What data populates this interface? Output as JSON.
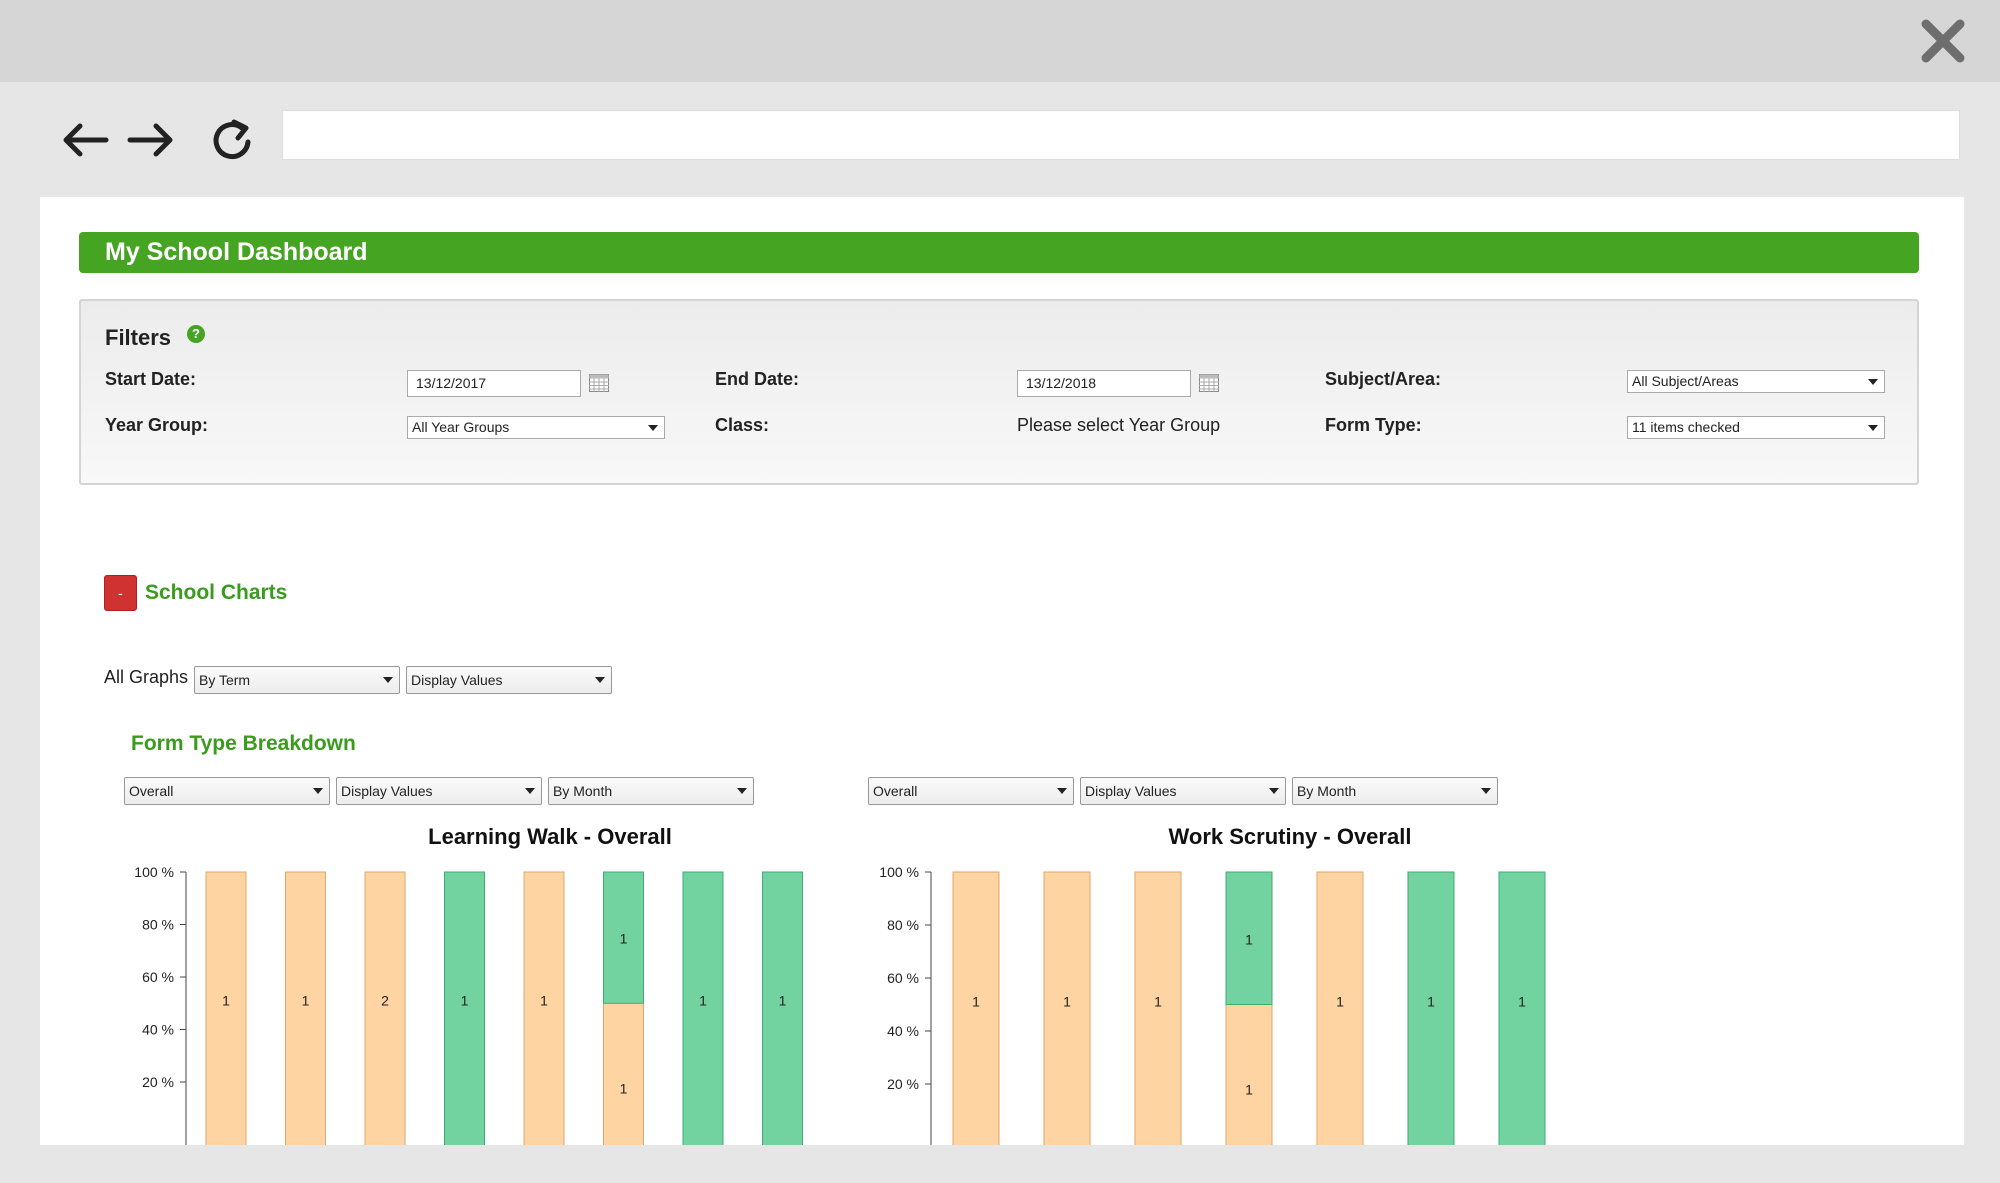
{
  "browser": {
    "close_icon": "close-icon",
    "back_icon": "arrow-left-icon",
    "forward_icon": "arrow-right-icon",
    "reload_icon": "reload-icon",
    "address": ""
  },
  "page": {
    "title": "My School Dashboard",
    "accent": "#45a422"
  },
  "filters": {
    "title": "Filters",
    "help": "?",
    "start_date_label": "Start Date:",
    "start_date_value": "13/12/2017",
    "end_date_label": "End Date:",
    "end_date_value": "13/12/2018",
    "subject_label": "Subject/Area:",
    "subject_value": "All Subject/Areas",
    "year_group_label": "Year Group:",
    "year_group_value": "All Year Groups",
    "class_label": "Class:",
    "class_value": "Please select Year Group",
    "form_type_label": "Form Type:",
    "form_type_value": "11 items checked"
  },
  "charts_section": {
    "collapse_label": "-",
    "title": "School Charts",
    "all_graphs_label": "All Graphs",
    "period_select": "By Term",
    "display_select": "Display Values",
    "breakdown_title": "Form Type Breakdown"
  },
  "chart_controls": [
    {
      "scope": "Overall",
      "display": "Display Values",
      "period": "By Month"
    },
    {
      "scope": "Overall",
      "display": "Display Values",
      "period": "By Month"
    }
  ],
  "chart_data": [
    {
      "type": "bar",
      "stacked": true,
      "title": "Learning Walk - Overall",
      "y_ticks": [
        "100 %",
        "80 %",
        "60 %",
        "40 %",
        "20 %"
      ],
      "ylim": [
        0,
        100
      ],
      "colors": {
        "orange": "#ffd4a3",
        "green": "#72d3a1"
      },
      "bars": [
        {
          "orange_pct": 100,
          "green_pct": 0,
          "orange_label": "1",
          "green_label": ""
        },
        {
          "orange_pct": 100,
          "green_pct": 0,
          "orange_label": "1",
          "green_label": ""
        },
        {
          "orange_pct": 100,
          "green_pct": 0,
          "orange_label": "2",
          "green_label": ""
        },
        {
          "orange_pct": 0,
          "green_pct": 100,
          "orange_label": "",
          "green_label": "1"
        },
        {
          "orange_pct": 100,
          "green_pct": 0,
          "orange_label": "1",
          "green_label": ""
        },
        {
          "orange_pct": 50,
          "green_pct": 50,
          "orange_label": "1",
          "green_label": "1"
        },
        {
          "orange_pct": 0,
          "green_pct": 100,
          "orange_label": "",
          "green_label": "1"
        },
        {
          "orange_pct": 0,
          "green_pct": 100,
          "orange_label": "",
          "green_label": "1"
        }
      ]
    },
    {
      "type": "bar",
      "stacked": true,
      "title": "Work Scrutiny - Overall",
      "y_ticks": [
        "100 %",
        "80 %",
        "60 %",
        "40 %",
        "20 %"
      ],
      "ylim": [
        0,
        100
      ],
      "colors": {
        "orange": "#ffd4a3",
        "green": "#72d3a1"
      },
      "bars": [
        {
          "orange_pct": 100,
          "green_pct": 0,
          "orange_label": "1",
          "green_label": ""
        },
        {
          "orange_pct": 100,
          "green_pct": 0,
          "orange_label": "1",
          "green_label": ""
        },
        {
          "orange_pct": 100,
          "green_pct": 0,
          "orange_label": "1",
          "green_label": ""
        },
        {
          "orange_pct": 50,
          "green_pct": 50,
          "orange_label": "1",
          "green_label": "1"
        },
        {
          "orange_pct": 100,
          "green_pct": 0,
          "orange_label": "1",
          "green_label": ""
        },
        {
          "orange_pct": 0,
          "green_pct": 100,
          "orange_label": "",
          "green_label": "1"
        },
        {
          "orange_pct": 0,
          "green_pct": 100,
          "orange_label": "",
          "green_label": "1"
        }
      ]
    }
  ]
}
